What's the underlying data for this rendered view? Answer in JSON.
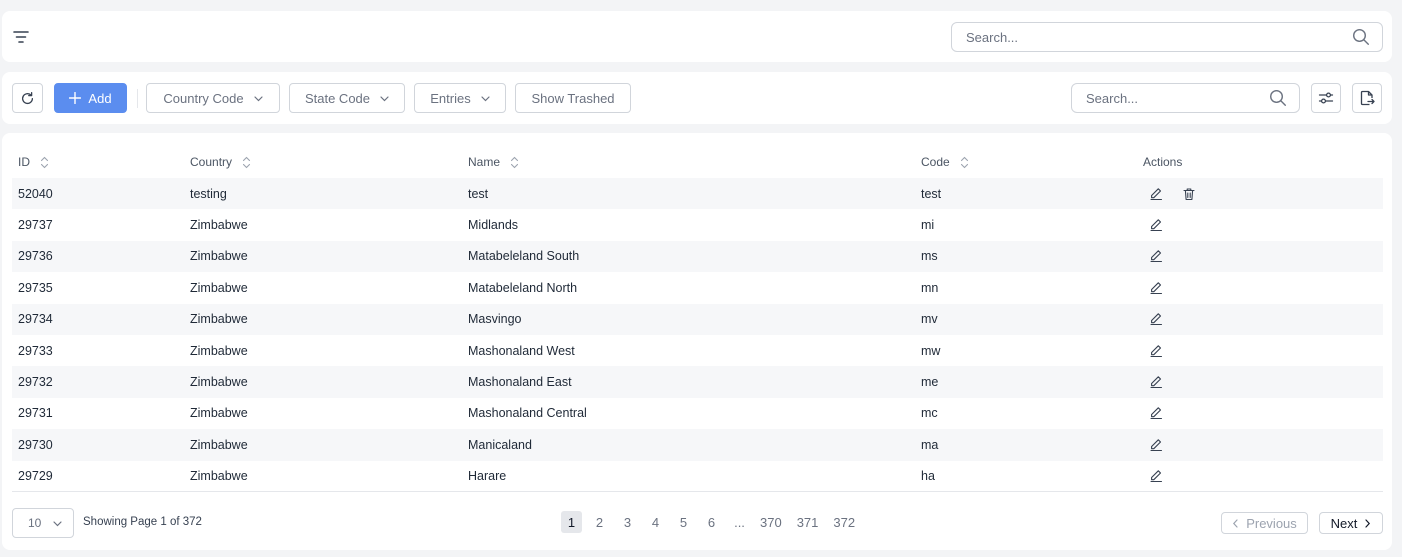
{
  "topbar": {
    "search_placeholder": "Search..."
  },
  "toolbar": {
    "add_label": "Add",
    "country_code_label": "Country Code",
    "state_code_label": "State Code",
    "entries_label": "Entries",
    "show_trashed_label": "Show Trashed",
    "search_placeholder": "Search..."
  },
  "table": {
    "headers": {
      "id": "ID",
      "country": "Country",
      "name": "Name",
      "code": "Code",
      "actions": "Actions"
    },
    "rows": [
      {
        "id": "52040",
        "country": "testing",
        "name": "test",
        "code": "test",
        "deletable": true
      },
      {
        "id": "29737",
        "country": "Zimbabwe",
        "name": "Midlands",
        "code": "mi"
      },
      {
        "id": "29736",
        "country": "Zimbabwe",
        "name": "Matabeleland South",
        "code": "ms"
      },
      {
        "id": "29735",
        "country": "Zimbabwe",
        "name": "Matabeleland North",
        "code": "mn"
      },
      {
        "id": "29734",
        "country": "Zimbabwe",
        "name": "Masvingo",
        "code": "mv"
      },
      {
        "id": "29733",
        "country": "Zimbabwe",
        "name": "Mashonaland West",
        "code": "mw"
      },
      {
        "id": "29732",
        "country": "Zimbabwe",
        "name": "Mashonaland East",
        "code": "me"
      },
      {
        "id": "29731",
        "country": "Zimbabwe",
        "name": "Mashonaland Central",
        "code": "mc"
      },
      {
        "id": "29730",
        "country": "Zimbabwe",
        "name": "Manicaland",
        "code": "ma"
      },
      {
        "id": "29729",
        "country": "Zimbabwe",
        "name": "Harare",
        "code": "ha"
      }
    ]
  },
  "footer": {
    "per_page": "10",
    "showing_text": "Showing Page 1 of 372",
    "pages": [
      "1",
      "2",
      "3",
      "4",
      "5",
      "6",
      "...",
      "370",
      "371",
      "372"
    ],
    "active_page": "1",
    "previous_label": "Previous",
    "next_label": "Next"
  },
  "icons": [
    "filter-icon",
    "search-icon",
    "refresh-icon",
    "plus-icon",
    "chevron-down-icon",
    "sliders-icon",
    "file-export-icon",
    "sort-icon",
    "pencil-icon",
    "trash-icon",
    "chevron-left-icon",
    "chevron-right-icon"
  ],
  "colors": {
    "primary": "#5b8def",
    "background": "#f3f4f6",
    "stripe": "#f6f7f9"
  }
}
